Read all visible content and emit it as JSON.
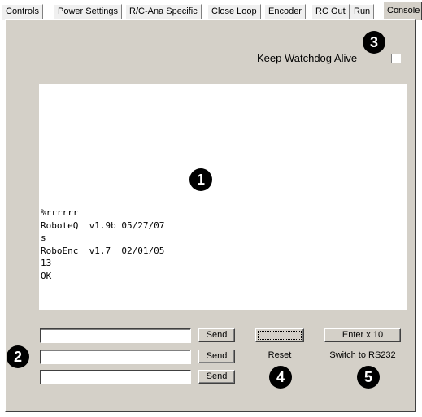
{
  "tabs": [
    {
      "label": "Controls"
    },
    {
      "label": "Power Settings"
    },
    {
      "label": "R/C-Ana Specific"
    },
    {
      "label": "Close Loop"
    },
    {
      "label": "Encoder"
    },
    {
      "label": "RC Out"
    },
    {
      "label": "Run"
    },
    {
      "label": "Console"
    }
  ],
  "active_tab": "Console",
  "watchdog": {
    "label": "Keep Watchdog Alive",
    "checked": false
  },
  "console": {
    "lines": "%rrrrrr\nRoboteQ  v1.9b 05/27/07\ns\nRoboEnc  v1.7  02/01/05\n13\nOK"
  },
  "send_rows": [
    {
      "value": "",
      "send_label": "Send"
    },
    {
      "value": "",
      "send_label": "Send"
    },
    {
      "value": "",
      "send_label": "Send"
    }
  ],
  "reset": {
    "button_label": "",
    "label": "Reset"
  },
  "enter": {
    "button_label": "Enter x 10",
    "label": "Switch to RS232"
  },
  "callouts": {
    "c1": "1",
    "c2": "2",
    "c3": "3",
    "c4": "4",
    "c5": "5"
  }
}
